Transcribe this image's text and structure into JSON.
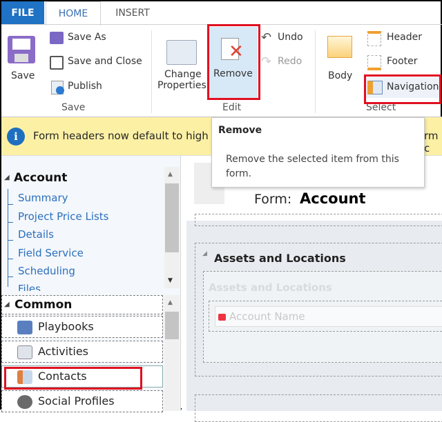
{
  "tabs": {
    "file": "FILE",
    "home": "HOME",
    "insert": "INSERT"
  },
  "ribbon": {
    "save": "Save",
    "save_as": "Save As",
    "save_and_close": "Save and Close",
    "publish": "Publish",
    "save_group": "Save",
    "change_properties_1": "Change",
    "change_properties_2": "Properties",
    "remove": "Remove",
    "undo": "Undo",
    "redo": "Redo",
    "edit_group": "Edit",
    "body": "Body",
    "header": "Header",
    "footer": "Footer",
    "navigation": "Navigation",
    "select_group": "Select"
  },
  "infobar": {
    "text_left": "Form headers now default to high d",
    "text_right": "rm c"
  },
  "tooltip": {
    "title": "Remove",
    "description": "Remove the selected item from this form."
  },
  "sidebar": {
    "account_heading": "Account",
    "account_links": [
      "Summary",
      "Project Price Lists",
      "Details",
      "Field Service",
      "Scheduling",
      "Files"
    ],
    "common_heading": "Common",
    "common_items": [
      "Playbooks",
      "Activities",
      "Contacts",
      "Social Profiles"
    ]
  },
  "form": {
    "label": "Form:",
    "name": "Account",
    "section_title": "Assets and Locations",
    "section_label": "Assets and Locations",
    "field": "Account Name"
  },
  "colors": {
    "file_tab": "#1f72c4",
    "highlight": "#e01020",
    "link": "#2a6fbe",
    "infobar": "#fcf0a5"
  }
}
